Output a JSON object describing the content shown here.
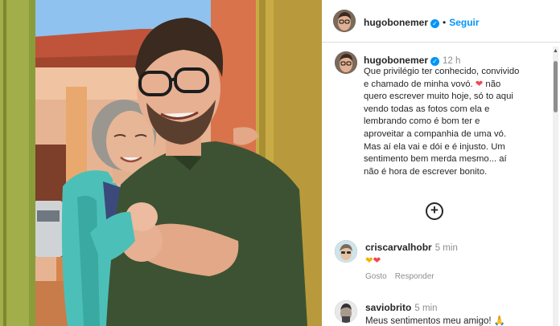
{
  "header": {
    "username": "hugobonemer",
    "separator": "•",
    "follow_label": "Seguir"
  },
  "caption": {
    "username": "hugobonemer",
    "time": "12 h",
    "line1": "Que privilégio ter conhecido, convivido",
    "line2": "e chamado de minha vovó.",
    "line2_suffix": "não",
    "line3": "quero escrever muito hoje, só to aqui",
    "line4": "vendo todas as fotos com ela e",
    "line5": "lembrando como é bom ter e",
    "line6": "aproveitar a companhia de uma vó.",
    "line7": "Mas aí ela vai e dói e é injusto. Um",
    "line8": "sentimento bem merda mesmo... aí",
    "line9": "não é hora de escrever bonito."
  },
  "load_more": {
    "icon": "plus-circle-icon",
    "glyph": "+"
  },
  "comments": [
    {
      "username": "criscarvalhobr",
      "time": "5 min",
      "text": "",
      "emoji": [
        "yellow-heart-icon",
        "red-heart-icon"
      ],
      "like_label": "Gosto",
      "reply_label": "Responder"
    },
    {
      "username": "saviobrito",
      "time": "5 min",
      "text": "Meus sentimentos meu amigo!",
      "emoji": [
        "folded-hands-icon"
      ]
    }
  ],
  "colors": {
    "link_blue": "#0095f6",
    "verified_blue": "#0095f6",
    "heart_red": "#ed4956",
    "heart_yellow": "#f4b400",
    "muted_text": "#8e8e8e",
    "divider": "#dbdbdb"
  }
}
